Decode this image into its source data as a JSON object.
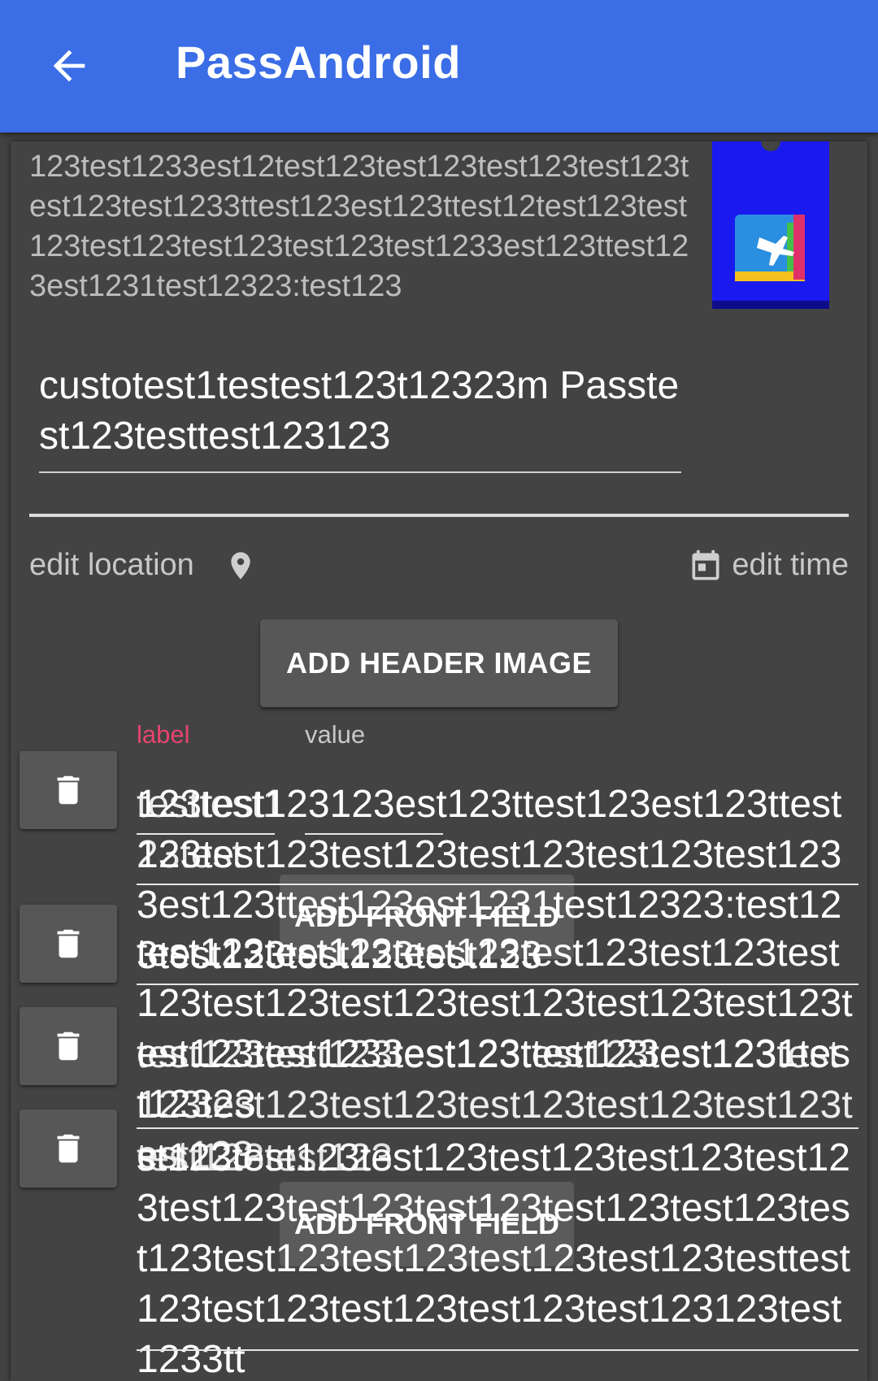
{
  "app_bar": {
    "title": "PassAndroid",
    "back_icon": "arrow-back-icon",
    "color": "#3a6de6"
  },
  "pass": {
    "description": "123test1233est12test123test123test123test123test123test1233ttest123est123ttest12test123test123test123test123test123test1233est123ttest123est1231test12323:test123",
    "name": "custotest1testest123t12323m Passtest123testtest123123",
    "icon_name": "airplane-boarding-pass-icon",
    "edit_location_label": "edit location",
    "edit_time_label": "edit time",
    "add_header_image_label": "ADD HEADER IMAGE"
  },
  "fields": {
    "label_header": "label",
    "value_header": "value",
    "label_color": "#e8446e",
    "rows": [
      {
        "label": "testtest123test",
        "value": "123test123123est123ttest123est123ttest123test123test123test123test123test1233est123ttest123est1231test12323:test123test123test123test123"
      },
      {
        "label": "test123test123",
        "value": "test123test123test123test123test123test123test123test123test123test123test123test123test1233est123ttest123est1231test12323"
      },
      {
        "label": "test123test123",
        "value": "test123test123test123test123test123test123test123test123test123test123test123test123"
      },
      {
        "label": "test123test123",
        "value": "st123test123test123test123test123test123test123test123test123test123test123test123test123test123test123test123testtest123test123test123test123test123123test1233tt"
      }
    ],
    "add_front_field_label": "ADD FRONT FIELD"
  }
}
